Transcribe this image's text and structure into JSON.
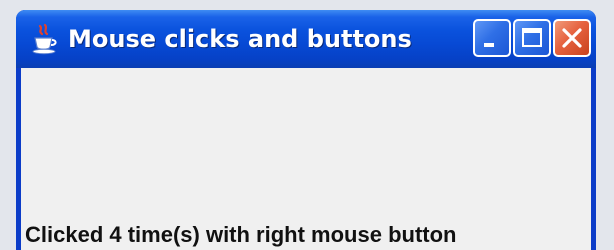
{
  "window": {
    "title": "Mouse clicks and buttons",
    "app_icon": "java-coffee-cup-icon",
    "controls": {
      "minimize_icon": "minimize-icon",
      "maximize_icon": "maximize-icon",
      "close_icon": "close-icon"
    }
  },
  "content": {
    "status_text": "Clicked 4 time(s) with right mouse button"
  },
  "colors": {
    "titlebar": "#0a52dd",
    "client_background": "#f0f0f0",
    "close_button": "#e6623f",
    "text": "#111111"
  }
}
